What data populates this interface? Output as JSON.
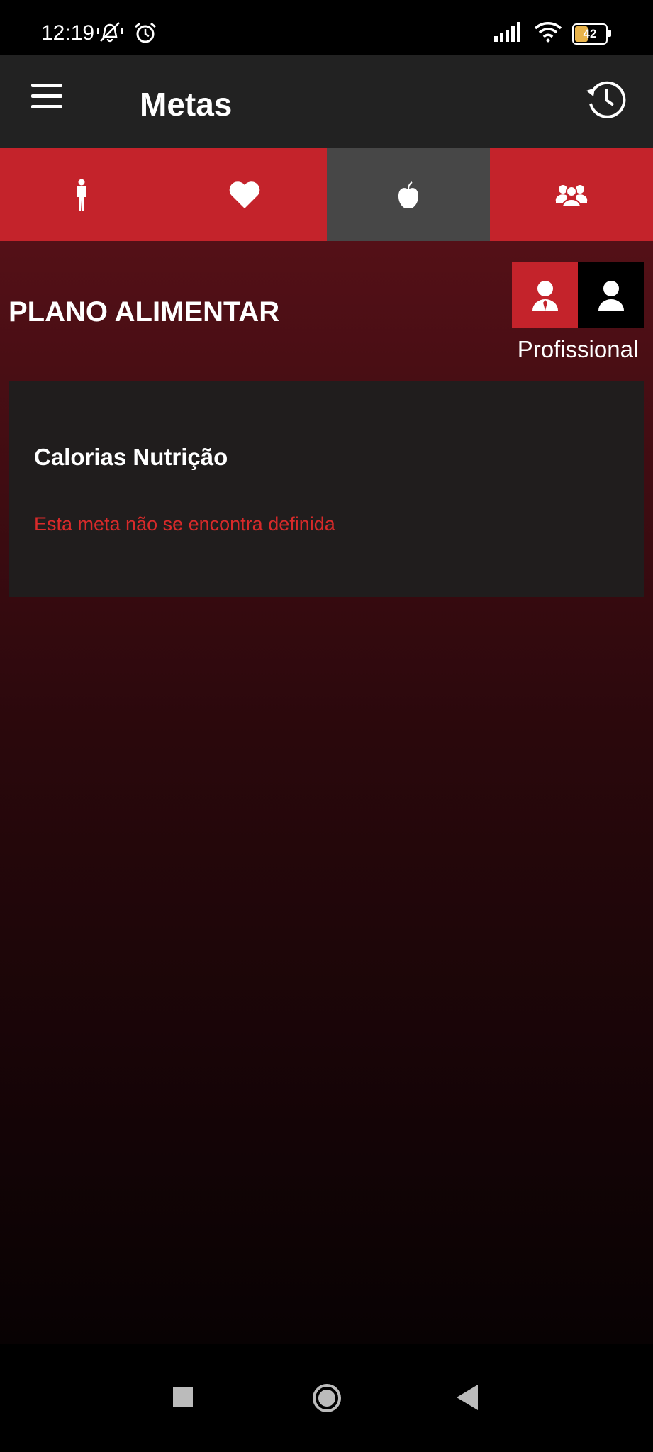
{
  "status_bar": {
    "time": "12:19",
    "battery_level": "42",
    "icons": [
      "notifications-off-icon",
      "alarm-icon",
      "signal-icon",
      "wifi-icon",
      "battery-icon"
    ]
  },
  "app_bar": {
    "title": "Metas",
    "icons": [
      "menu-icon",
      "history-icon"
    ]
  },
  "tabs": [
    {
      "icon": "body-icon",
      "active": false
    },
    {
      "icon": "heart-icon",
      "active": false
    },
    {
      "icon": "apple-icon",
      "active": true
    },
    {
      "icon": "group-icon",
      "active": false
    }
  ],
  "section": {
    "title": "PLANO ALIMENTAR",
    "toggle_caption": "Profissional",
    "toggle_icons": [
      "professional-user-icon",
      "user-icon"
    ]
  },
  "goal_card": {
    "title": "Calorias Nutrição",
    "message": "Esta meta não se encontra definida"
  },
  "colors": {
    "accent_red": "#c4232b",
    "active_tab": "#474747",
    "card_bg": "#201d1d",
    "warning_text": "#d82a2a",
    "app_bar_bg": "#222222"
  },
  "nav_bar": {
    "icons": [
      "recent-apps-icon",
      "home-icon",
      "back-icon"
    ]
  }
}
